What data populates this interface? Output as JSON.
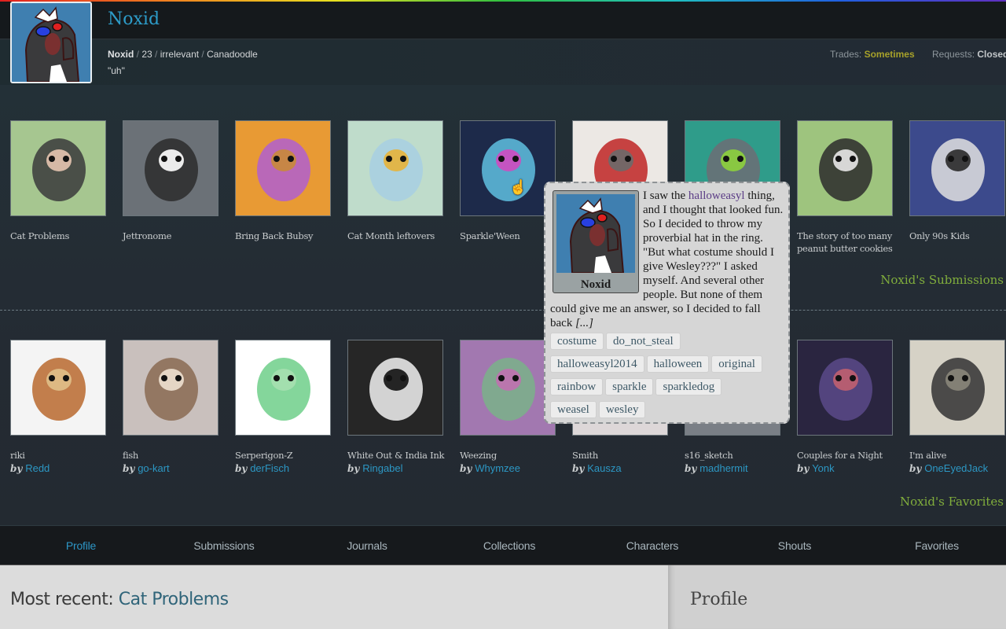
{
  "header": {
    "username": "Noxid",
    "meta": {
      "name": "Noxid",
      "age": "23",
      "gender": "irrelevant",
      "location": "Canadoodle"
    },
    "status_quote": "\"uh\"",
    "trades_label": "Trades:",
    "trades_value": "Sometimes",
    "requests_label": "Requests:",
    "requests_value": "Closed"
  },
  "submissions": {
    "section_label": "Noxid's Submissions",
    "items": [
      {
        "title": "Cat Problems",
        "icon": "comic-thumbnail"
      },
      {
        "title": "Jettronome",
        "icon": "character-thumbnail"
      },
      {
        "title": "Bring Back Bubsy",
        "icon": "badge-thumbnail"
      },
      {
        "title": "Cat Month leftovers",
        "icon": "cat-thumbnail"
      },
      {
        "title": "Sparkle'Ween",
        "icon": "costume-thumbnail"
      },
      {
        "title": "",
        "icon": "meme-thumbnail"
      },
      {
        "title": "",
        "icon": "character-thumbnail"
      },
      {
        "title": "The story of too many peanut butter cookies",
        "icon": "comic-thumbnail"
      },
      {
        "title": "Only 90s Kids",
        "icon": "comic-thumbnail"
      }
    ]
  },
  "favorites": {
    "section_label": "Noxid's Favorites",
    "by_label": "by",
    "items": [
      {
        "title": "riki",
        "author": "Redd"
      },
      {
        "title": "fish",
        "author": "go-kart"
      },
      {
        "title": "Serperigon-Z",
        "author": "derFisch"
      },
      {
        "title": "White Out & India Ink",
        "author": "Ringabel"
      },
      {
        "title": "Weezing",
        "author": "Whymzee"
      },
      {
        "title": "Smith",
        "author": "Kausza"
      },
      {
        "title": "s16_sketch",
        "author": "madhermit"
      },
      {
        "title": "Couples for a Night",
        "author": "Yonk"
      },
      {
        "title": "I'm alive",
        "author": "OneEyedJack"
      }
    ]
  },
  "tooltip": {
    "avatar_name": "Noxid",
    "text_before_link": "I saw the ",
    "link_text": "halloweasyl",
    "text_after_link": " thing, and I thought that looked fun. So I decided to throw my proverbial hat in the ring.",
    "text_line2": "\"But what costume should I give Wesley???\" I asked myself. And several other people. But none of them could give me an answer, so I decided to fall back ",
    "ellipsis": "[...]",
    "tags": [
      "costume",
      "do_not_steal",
      "halloweasyl2014",
      "halloween",
      "original",
      "rainbow",
      "sparkle",
      "sparkledog",
      "weasel",
      "wesley"
    ]
  },
  "nav": {
    "items": [
      "Profile",
      "Submissions",
      "Journals",
      "Collections",
      "Characters",
      "Shouts",
      "Favorites"
    ],
    "active": "Profile"
  },
  "recent": {
    "label": "Most recent: ",
    "link": "Cat Problems"
  },
  "profile_panel": {
    "title": "Profile"
  }
}
